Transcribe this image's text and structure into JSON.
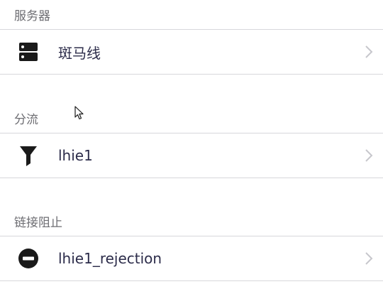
{
  "sections": [
    {
      "header": "服务器",
      "row": {
        "label": "斑马线",
        "icon": "server-icon"
      }
    },
    {
      "header": "分流",
      "row": {
        "label": "lhie1",
        "icon": "funnel-icon"
      }
    },
    {
      "header": "链接阻止",
      "row": {
        "label": "lhie1_rejection",
        "icon": "block-icon"
      }
    }
  ],
  "colors": {
    "header_text": "#6d6d72",
    "row_text": "#2c2c4a",
    "icon": "#1a1a1a",
    "separator": "#d7d7db",
    "chevron": "#c7c7cc"
  }
}
